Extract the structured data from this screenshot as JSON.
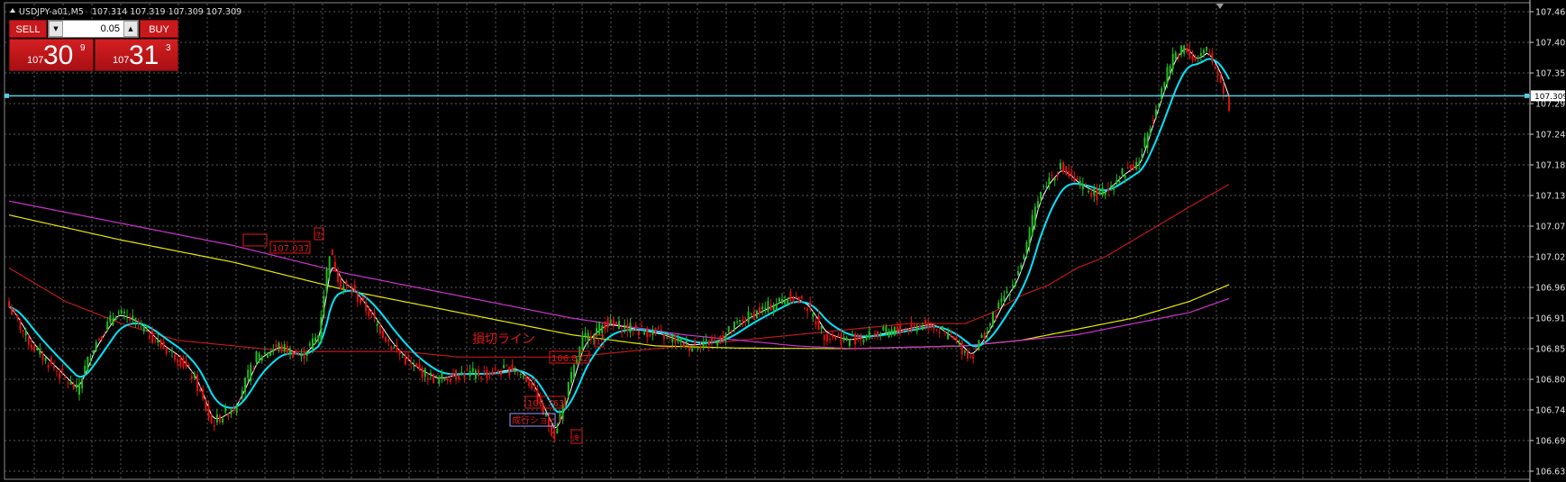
{
  "header": {
    "symbol_info": "USDJPY-a01,M5   107.314 107.319 107.309 107.309"
  },
  "trade_panel": {
    "sell_label": "SELL",
    "buy_label": "BUY",
    "lot": "0.05",
    "sell_price": {
      "small": "107",
      "big": "30",
      "sup": "9"
    },
    "buy_price": {
      "small": "107",
      "big": "31",
      "sup": "3"
    }
  },
  "price_axis": {
    "ticks": [
      "107.460",
      "107.405",
      "107.350",
      "107.295",
      "107.240",
      "107.185",
      "107.130",
      "107.075",
      "107.020",
      "106.965",
      "106.910",
      "106.855",
      "106.800",
      "106.745",
      "106.690",
      "106.635"
    ],
    "current_price": "107.309"
  },
  "annotations": {
    "entry_marker": "⑦",
    "entry_price": "107.037",
    "stop_line_label": "損切ライン",
    "price_2": "106.832",
    "price_3": "106.763",
    "extra_label": "成行ショート",
    "marker_2": "①",
    "marker_3": "⑨"
  },
  "colors": {
    "background": "#000000",
    "grid": "#5a5a5a",
    "bull": "#22bb22",
    "bear": "#e01010",
    "ma_fast": "#ffffff",
    "ma_mid": "#00e5ff",
    "ma_slow_red": "#c0181a",
    "ma_yellow": "#e8e800",
    "ma_magenta": "#cc33cc",
    "bid_line": "#4fd0e8",
    "annotation": "#e01818"
  },
  "chart_data": {
    "type": "candlestick",
    "symbol": "USDJPY-a01",
    "timeframe": "M5",
    "ylim": [
      106.635,
      107.46
    ],
    "bid": 107.309,
    "close_anchors": [
      [
        0,
        106.93
      ],
      [
        8,
        106.86
      ],
      [
        16,
        106.82
      ],
      [
        24,
        106.78
      ],
      [
        30,
        106.86
      ],
      [
        38,
        106.92
      ],
      [
        46,
        106.9
      ],
      [
        54,
        106.86
      ],
      [
        60,
        106.84
      ],
      [
        66,
        106.8
      ],
      [
        72,
        106.72
      ],
      [
        80,
        106.75
      ],
      [
        88,
        106.84
      ],
      [
        96,
        106.86
      ],
      [
        104,
        106.84
      ],
      [
        110,
        106.88
      ],
      [
        114,
        107.03
      ],
      [
        118,
        106.97
      ],
      [
        122,
        106.96
      ],
      [
        128,
        106.92
      ],
      [
        136,
        106.86
      ],
      [
        144,
        106.82
      ],
      [
        152,
        106.8
      ],
      [
        160,
        106.81
      ],
      [
        170,
        106.81
      ],
      [
        180,
        106.82
      ],
      [
        186,
        106.79
      ],
      [
        190,
        106.74
      ],
      [
        194,
        106.7
      ],
      [
        198,
        106.77
      ],
      [
        204,
        106.87
      ],
      [
        212,
        106.9
      ],
      [
        222,
        106.89
      ],
      [
        232,
        106.88
      ],
      [
        242,
        106.86
      ],
      [
        252,
        106.87
      ],
      [
        262,
        106.91
      ],
      [
        270,
        106.93
      ],
      [
        278,
        106.95
      ],
      [
        284,
        106.93
      ],
      [
        290,
        106.88
      ],
      [
        298,
        106.87
      ],
      [
        308,
        106.88
      ],
      [
        318,
        106.89
      ],
      [
        328,
        106.9
      ],
      [
        336,
        106.87
      ],
      [
        342,
        106.84
      ],
      [
        348,
        106.89
      ],
      [
        354,
        106.95
      ],
      [
        358,
        106.98
      ],
      [
        362,
        107.04
      ],
      [
        366,
        107.13
      ],
      [
        370,
        107.16
      ],
      [
        374,
        107.18
      ],
      [
        380,
        107.15
      ],
      [
        388,
        107.13
      ],
      [
        396,
        107.17
      ],
      [
        402,
        107.19
      ],
      [
        406,
        107.26
      ],
      [
        410,
        107.32
      ],
      [
        414,
        107.38
      ],
      [
        418,
        107.4
      ],
      [
        422,
        107.37
      ],
      [
        426,
        107.39
      ],
      [
        430,
        107.35
      ],
      [
        434,
        107.29
      ]
    ],
    "moving_averages": [
      {
        "key": "ma_slow_red",
        "anchors": [
          [
            0,
            107.0
          ],
          [
            20,
            106.94
          ],
          [
            40,
            106.9
          ],
          [
            60,
            106.87
          ],
          [
            80,
            106.86
          ],
          [
            100,
            106.85
          ],
          [
            120,
            106.85
          ],
          [
            140,
            106.85
          ],
          [
            160,
            106.84
          ],
          [
            180,
            106.84
          ],
          [
            200,
            106.84
          ],
          [
            220,
            106.85
          ],
          [
            240,
            106.86
          ],
          [
            260,
            106.87
          ],
          [
            280,
            106.88
          ],
          [
            300,
            106.89
          ],
          [
            320,
            106.9
          ],
          [
            340,
            106.9
          ],
          [
            350,
            106.92
          ],
          [
            360,
            106.95
          ],
          [
            370,
            106.97
          ],
          [
            380,
            107.0
          ],
          [
            390,
            107.02
          ],
          [
            400,
            107.05
          ],
          [
            410,
            107.08
          ],
          [
            420,
            107.11
          ],
          [
            434,
            107.15
          ]
        ]
      },
      {
        "key": "ma_yellow",
        "anchors": [
          [
            0,
            107.095
          ],
          [
            40,
            107.05
          ],
          [
            80,
            107.01
          ],
          [
            120,
            106.96
          ],
          [
            160,
            106.92
          ],
          [
            200,
            106.88
          ],
          [
            230,
            106.86
          ],
          [
            260,
            106.856
          ],
          [
            300,
            106.855
          ],
          [
            340,
            106.86
          ],
          [
            360,
            106.87
          ],
          [
            380,
            106.89
          ],
          [
            400,
            106.91
          ],
          [
            420,
            106.94
          ],
          [
            434,
            106.97
          ]
        ]
      },
      {
        "key": "ma_magenta",
        "anchors": [
          [
            0,
            107.12
          ],
          [
            40,
            107.08
          ],
          [
            80,
            107.04
          ],
          [
            120,
            106.99
          ],
          [
            160,
            106.95
          ],
          [
            200,
            106.91
          ],
          [
            240,
            106.88
          ],
          [
            260,
            106.87
          ],
          [
            280,
            106.86
          ],
          [
            300,
            106.855
          ],
          [
            340,
            106.86
          ],
          [
            360,
            106.87
          ],
          [
            380,
            106.88
          ],
          [
            400,
            106.9
          ],
          [
            420,
            106.92
          ],
          [
            434,
            106.945
          ]
        ]
      }
    ]
  }
}
